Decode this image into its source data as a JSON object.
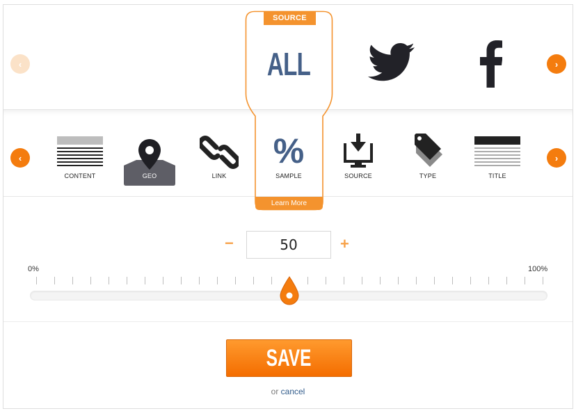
{
  "sources": {
    "badge_label": "SOURCE",
    "all_label": "ALL",
    "items": [
      {
        "name": "all",
        "icon": "all-text"
      },
      {
        "name": "twitter",
        "icon": "twitter-bird-icon"
      },
      {
        "name": "facebook",
        "icon": "facebook-f-icon"
      }
    ]
  },
  "types": {
    "items": [
      {
        "label": "CONTENT",
        "icon": "content-lines-icon"
      },
      {
        "label": "GEO",
        "icon": "map-pin-icon"
      },
      {
        "label": "LINK",
        "icon": "chain-link-icon"
      },
      {
        "label": "SAMPLE",
        "icon": "percent-icon"
      },
      {
        "label": "SOURCE",
        "icon": "download-monitor-icon"
      },
      {
        "label": "TYPE",
        "icon": "tag-icon"
      },
      {
        "label": "TITLE",
        "icon": "title-lines-icon"
      }
    ],
    "learn_more_label": "Learn More",
    "sample_symbol": "%"
  },
  "stepper": {
    "minus_label": "−",
    "plus_label": "+",
    "value": "50"
  },
  "slider": {
    "min_label": "0%",
    "max_label": "100%",
    "value_percent": 50
  },
  "actions": {
    "save_label": "SAVE",
    "or_text": "or",
    "cancel_label": "cancel"
  },
  "colors": {
    "accent": "#f47c0e",
    "accent_light": "#f4932e",
    "all_text": "#456088",
    "icon_dark": "#222228"
  }
}
